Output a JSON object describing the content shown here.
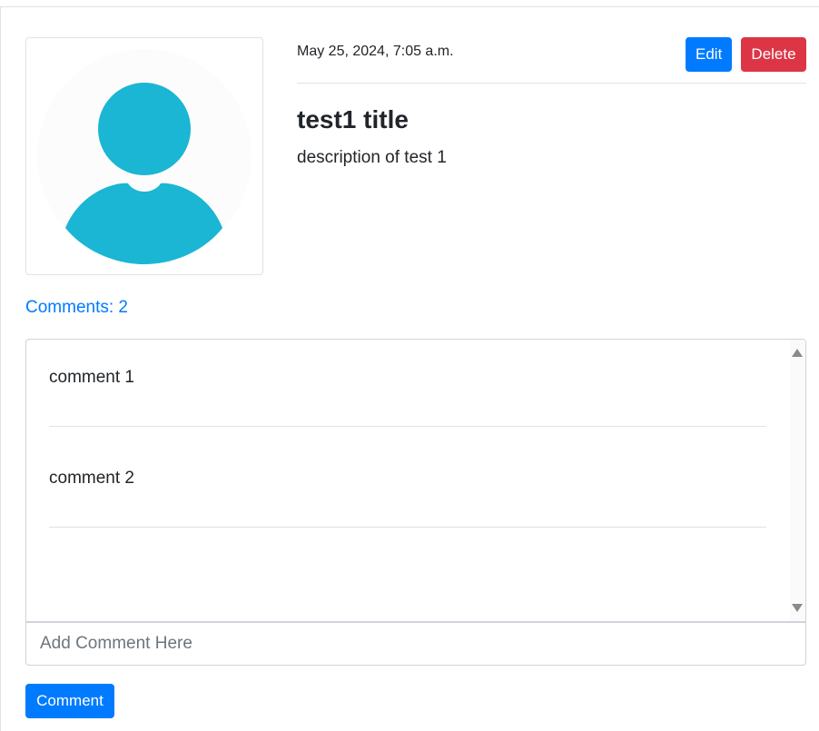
{
  "post": {
    "date": "May 25, 2024, 7:05 a.m.",
    "title": "test1 title",
    "description": "description of test 1",
    "edit_label": "Edit",
    "delete_label": "Delete",
    "avatar_icon": "user-silhouette-icon"
  },
  "comments": {
    "count_label": "Comments: 2",
    "items": [
      {
        "text": "comment 1"
      },
      {
        "text": "comment 2"
      }
    ],
    "input_placeholder": "Add Comment Here",
    "submit_label": "Comment"
  },
  "colors": {
    "primary": "#007bff",
    "danger": "#dc3545",
    "avatar": "#1ab6d3"
  }
}
